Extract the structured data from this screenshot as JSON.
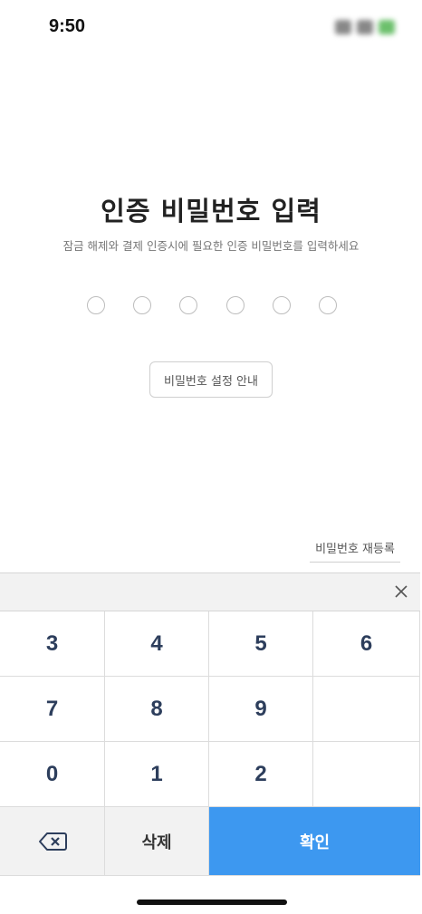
{
  "status_bar": {
    "time": "9:50"
  },
  "auth": {
    "title": "인증 비밀번호 입력",
    "subtitle": "잠금 해제와 결제 인증시에 필요한 인증 비밀번호를 입력하세요",
    "pin_length": 6,
    "pin_filled": 0,
    "guide_button": "비밀번호 설정 안내",
    "reregister_link": "비밀번호 재등록"
  },
  "keypad": {
    "rows": [
      [
        "3",
        "4",
        "5",
        "6"
      ],
      [
        "7",
        "8",
        "9",
        ""
      ],
      [
        "0",
        "1",
        "2",
        ""
      ]
    ],
    "delete_label": "삭제",
    "confirm_label": "확인",
    "confirm_color": "#3d98f0"
  }
}
